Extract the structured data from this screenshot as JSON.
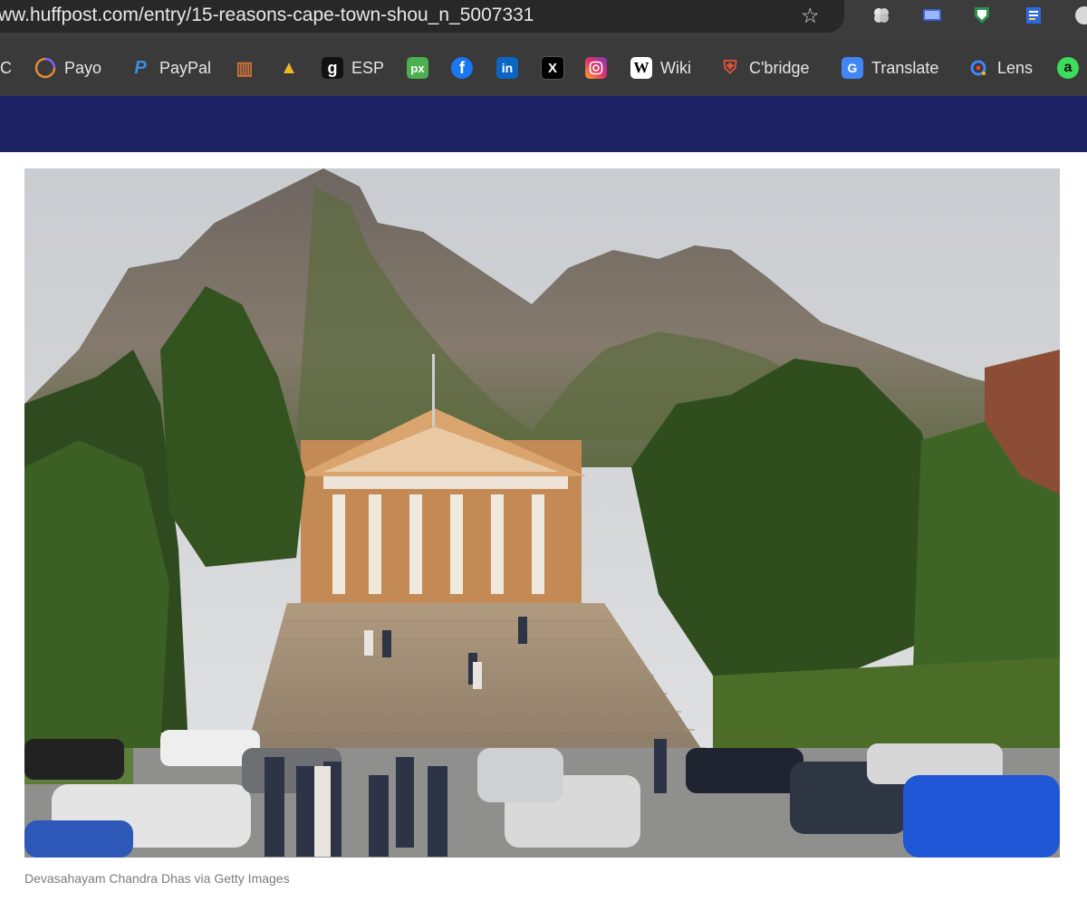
{
  "browser": {
    "url": "ww.huffpost.com/entry/15-reasons-cape-town-shou_n_5007331",
    "bookmark_cut_label": "C",
    "bookmarks": [
      {
        "label": "Payo",
        "icon": "ring-icon"
      },
      {
        "label": "PayPal",
        "icon": "paypal-icon"
      },
      {
        "label": "",
        "icon": "grid-icon"
      },
      {
        "label": "",
        "icon": "triangle-icon"
      },
      {
        "label": "ESP",
        "icon": "g-letter-icon"
      },
      {
        "label": "",
        "icon": "px-icon"
      },
      {
        "label": "",
        "icon": "facebook-icon"
      },
      {
        "label": "",
        "icon": "linkedin-icon"
      },
      {
        "label": "",
        "icon": "x-icon"
      },
      {
        "label": "",
        "icon": "instagram-icon"
      },
      {
        "label": "Wiki",
        "icon": "wikipedia-icon"
      },
      {
        "label": "C'bridge",
        "icon": "crest-icon"
      },
      {
        "label": "Translate",
        "icon": "translate-icon"
      },
      {
        "label": "Lens",
        "icon": "lens-icon"
      },
      {
        "label": "",
        "icon": "a-letter-icon"
      }
    ],
    "icon_glyphs": {
      "g_letter": "g",
      "px": "px",
      "facebook": "f",
      "linkedin": "in",
      "x": "X",
      "wikipedia": "W",
      "translate": "G",
      "a_letter": "a",
      "paypal": "P",
      "grid": "▥",
      "triangle": "▲",
      "crest": "⛨",
      "star": "☆"
    }
  },
  "colors": {
    "site_header": "#1c2164",
    "chrome_bg": "#3a3a3a",
    "caption_text": "#7b7b7b"
  },
  "article": {
    "image_caption": "Devasahayam Chandra Dhas via Getty Images"
  }
}
